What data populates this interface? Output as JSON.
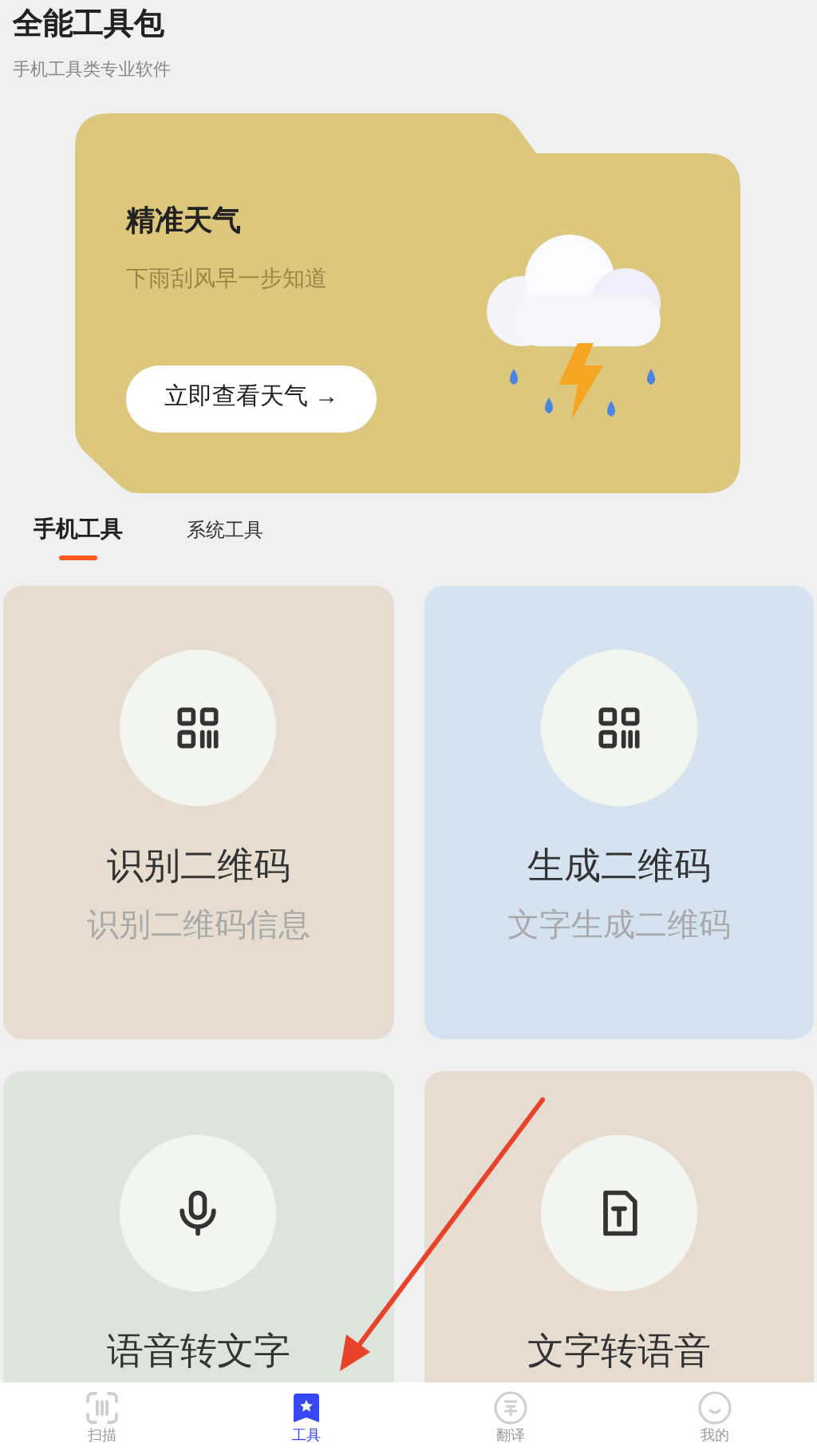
{
  "header": {
    "title": "全能工具包",
    "subtitle": "手机工具类专业软件"
  },
  "banner": {
    "title": "精准天气",
    "subtitle": "下雨刮风早一步知道",
    "button": "立即查看天气",
    "button_arrow": "→"
  },
  "tabs": [
    {
      "label": "手机工具",
      "selected": true
    },
    {
      "label": "系统工具",
      "selected": false
    }
  ],
  "tools": [
    {
      "kind": "qr",
      "title": "识别二维码",
      "subtitle": "识别二维码信息",
      "color": "#e6ddd0"
    },
    {
      "kind": "qr",
      "title": "生成二维码",
      "subtitle": "文字生成二维码",
      "color": "#d5e2ef"
    },
    {
      "kind": "mic",
      "title": "语音转文字",
      "color": "#dde4dc"
    },
    {
      "kind": "doc",
      "title": "文字转语音",
      "color": "#e6ddd0"
    }
  ],
  "nav": [
    {
      "kind": "scan",
      "label": "扫描",
      "selected": false
    },
    {
      "kind": "tools",
      "label": "工具",
      "selected": true
    },
    {
      "kind": "translate",
      "label": "翻译",
      "selected": false
    },
    {
      "kind": "profile",
      "label": "我的",
      "selected": false
    }
  ]
}
